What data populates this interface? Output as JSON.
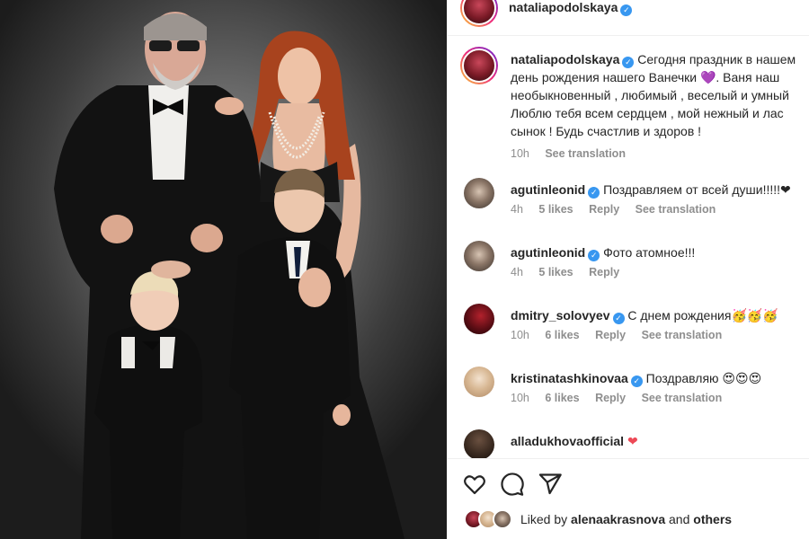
{
  "post": {
    "username": "nataliapodolskaya",
    "caption_user": "nataliapodolskaya",
    "caption_lines": [
      "Сегодня праздник в нашем",
      "день рождения нашего Ванечки 💜. Ваня наш",
      "необыкновенный , любимый , веселый и умный",
      "Люблю тебя всем сердцем , мой нежный и лас",
      "сынок ! Будь счастлив и здоров !"
    ],
    "caption_time": "10h",
    "see_translation": "See translation"
  },
  "comments": [
    {
      "user": "agutinleonid",
      "verified": true,
      "text": "Поздравляем от всей души!!!!!❤",
      "time": "4h",
      "likes": "5 likes",
      "reply": "Reply",
      "translation": "See translation"
    },
    {
      "user": "agutinleonid",
      "verified": true,
      "text": "Фото атомное!!!",
      "time": "4h",
      "likes": "5 likes",
      "reply": "Reply",
      "translation": ""
    },
    {
      "user": "dmitry_solovyev",
      "verified": true,
      "text": "С днем рождения🥳🥳🥳",
      "time": "10h",
      "likes": "6 likes",
      "reply": "Reply",
      "translation": "See translation"
    },
    {
      "user": "kristinatashkinovaa",
      "verified": true,
      "text": "Поздравляю 😍😍😍",
      "time": "10h",
      "likes": "6 likes",
      "reply": "Reply",
      "translation": "See translation"
    },
    {
      "user": "alladukhovaofficial",
      "verified": false,
      "text": "❤",
      "time": "",
      "likes": "",
      "reply": "",
      "translation": ""
    }
  ],
  "actions": {
    "like_icon": "heart-icon",
    "comment_icon": "comment-icon",
    "share_icon": "share-icon"
  },
  "liked_by": {
    "prefix": "Liked by",
    "user": "alenaakrasnova",
    "and": "and",
    "others": "others"
  },
  "colors": {
    "verified": "#3897f0",
    "muted_text": "#8e8e8e",
    "heart": "#ed4956"
  }
}
